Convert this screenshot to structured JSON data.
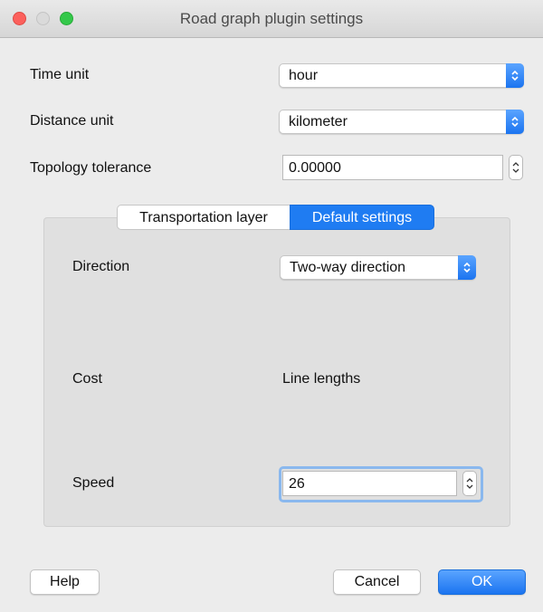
{
  "window": {
    "title": "Road graph plugin settings"
  },
  "fields": {
    "time_unit": {
      "label": "Time unit",
      "value": "hour"
    },
    "distance_unit": {
      "label": "Distance unit",
      "value": "kilometer"
    },
    "topology_tolerance": {
      "label": "Topology tolerance",
      "value": "0.00000"
    }
  },
  "tabs": [
    {
      "label": "Transportation layer",
      "active": false
    },
    {
      "label": "Default settings",
      "active": true
    }
  ],
  "defaults": {
    "direction": {
      "label": "Direction",
      "value": "Two-way direction"
    },
    "cost": {
      "label": "Cost",
      "value": "Line lengths"
    },
    "speed": {
      "label": "Speed",
      "value": "26"
    }
  },
  "buttons": {
    "help": "Help",
    "cancel": "Cancel",
    "ok": "OK"
  },
  "icons": {
    "close": "close-button",
    "minimize": "minimize-button",
    "maximize": "zoom-button",
    "dropdown": "chevron-updown-icon",
    "spinner": "stepper-icon"
  },
  "colors": {
    "accent": "#1f7cf2",
    "close": "#fc605c",
    "maximize": "#34c84a"
  }
}
